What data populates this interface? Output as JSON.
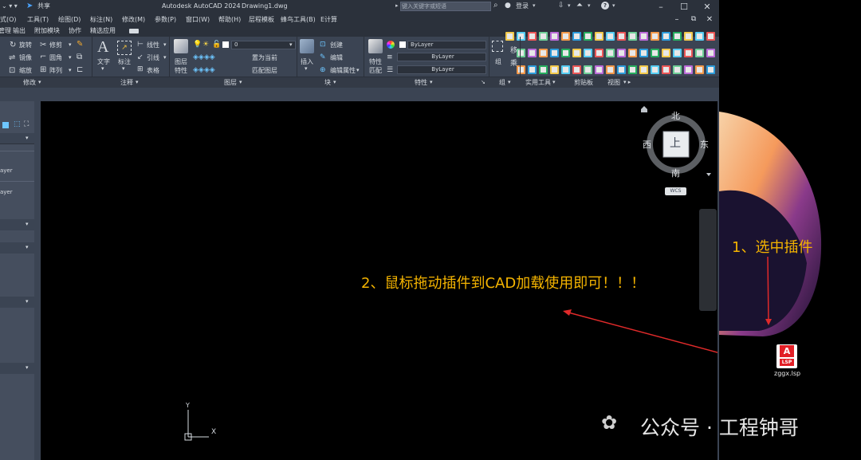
{
  "window": {
    "title": "Autodesk AutoCAD 2024",
    "file": "Drawing1.dwg",
    "share_label": "共享",
    "search_placeholder": "键入关键字或短语",
    "login_label": "登录"
  },
  "menu": {
    "items": [
      "式(O)",
      "工具(T)",
      "绘图(D)",
      "标注(N)",
      "修改(M)",
      "参数(P)",
      "窗口(W)",
      "帮助(H)",
      "层程模板",
      "蜂鸟工具(B)",
      "E计算"
    ]
  },
  "ribbon_tabs": [
    "管理",
    "输出",
    "附加模块",
    "协作",
    "精选应用"
  ],
  "ribbon": {
    "modify": {
      "items": [
        "旋转",
        "修剪",
        "镜像",
        "圆角",
        "缩放",
        "阵列"
      ],
      "panel_label": "修改"
    },
    "annotation": {
      "text_label": "文字",
      "dim_label": "标注",
      "items": [
        "线性",
        "引线",
        "表格"
      ],
      "panel_label": "注释"
    },
    "layers": {
      "props_label": "图层",
      "props_label2": "特性",
      "layer_value": "0",
      "items": [
        "置为当前",
        "匹配图层"
      ],
      "panel_label": "图层"
    },
    "block": {
      "insert_label": "插入",
      "items": [
        "创建",
        "编辑",
        "编辑属性"
      ],
      "panel_label": "块"
    },
    "properties": {
      "match_label": "特性",
      "match_label2": "匹配",
      "color_value": "ByLayer",
      "linetype_value": "ByLayer",
      "lineweight_value": "ByLayer",
      "panel_label": "特性"
    },
    "group": {
      "label": "组",
      "panel_label": "组"
    },
    "utilities": {
      "panel_label": "实用工具"
    },
    "clipboard": {
      "panel_label": "剪贴板"
    },
    "view": {
      "panel_label": "视图"
    }
  },
  "left_panel": {
    "rows": [
      "ayer",
      "ayer"
    ]
  },
  "viewcube": {
    "north": "北",
    "south": "南",
    "east": "东",
    "west": "西",
    "face": "上",
    "wcs": "WCS"
  },
  "ucs": {
    "x_label": "X",
    "y_label": "Y"
  },
  "annotations": {
    "step1": "1、选中插件",
    "step2": "2、鼠标拖动插件到CAD加载使用即可！！！",
    "file_label": "zggx.lsp",
    "file_badge": "LSP",
    "file_letter": "A"
  },
  "watermark": {
    "text": "公众号 · 工程钟哥"
  },
  "colors": {
    "annotation_text": "#f5b400",
    "arrow": "#e02a2a",
    "autocad_red": "#e21f26"
  }
}
